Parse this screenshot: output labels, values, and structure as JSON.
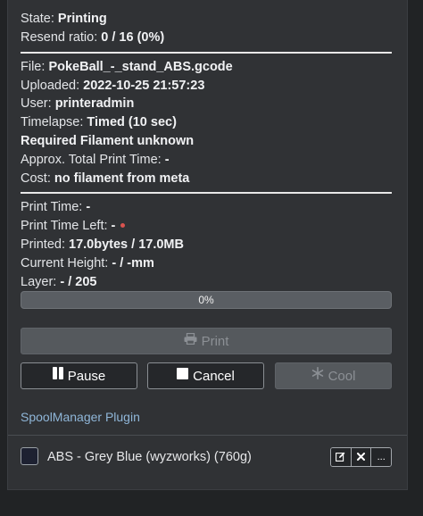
{
  "state": {
    "state_label": "State:",
    "state_value": "Printing",
    "resend_label": "Resend ratio:",
    "resend_value": "0 / 16 (0%)"
  },
  "job": {
    "file_label": "File:",
    "file_value": "PokeBall_-_stand_ABS.gcode",
    "uploaded_label": "Uploaded:",
    "uploaded_value": "2022-10-25 21:57:23",
    "user_label": "User:",
    "user_value": "printeradmin",
    "timelapse_label": "Timelapse:",
    "timelapse_value": "Timed (10 sec)",
    "filament_text": "Required Filament unknown",
    "approx_label": "Approx. Total Print Time:",
    "approx_value": "-",
    "cost_label": "Cost:",
    "cost_value": "no filament from meta"
  },
  "progress": {
    "print_time_label": "Print Time:",
    "print_time_value": "-",
    "time_left_label": "Print Time Left:",
    "time_left_value": "-",
    "printed_label": "Printed:",
    "printed_value": "17.0bytes / 17.0MB",
    "height_label": "Current Height:",
    "height_value": "- / -mm",
    "layer_label": "Layer:",
    "layer_value": "- / 205",
    "bar_text": "0%",
    "bar_fraction": 0
  },
  "controls": {
    "print_label": "Print",
    "pause_label": "Pause",
    "cancel_label": "Cancel",
    "cool_label": "Cool"
  },
  "spool_manager": {
    "title": "SpoolManager Plugin",
    "spool_name": "ABS - Grey Blue (wyzworks) (760g)",
    "swatch_color": "#1d2131",
    "more_label": "..."
  },
  "colors": {
    "panel_bg": "#303235",
    "accent_link": "#8fb6d8",
    "status_dot": "#d9534f"
  }
}
